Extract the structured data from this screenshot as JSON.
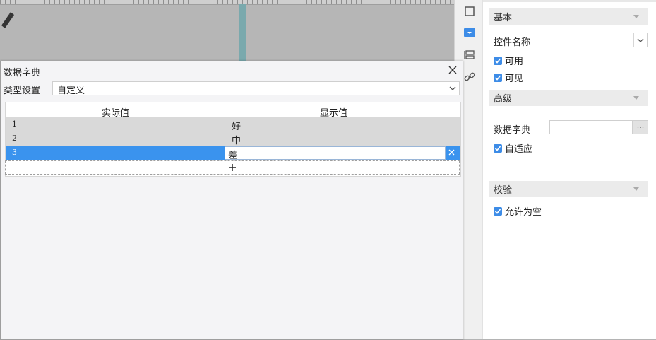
{
  "dialog": {
    "title": "数据字典",
    "type_label": "类型设置",
    "type_value": "自定义",
    "columns": [
      "实际值",
      "显示值"
    ],
    "rows": [
      {
        "actual": "1",
        "display": "好"
      },
      {
        "actual": "2",
        "display": "中"
      },
      {
        "actual": "3",
        "display": "差"
      }
    ]
  },
  "panel": {
    "basic_header": "基本",
    "control_name_label": "控件名称",
    "enabled_label": "可用",
    "visible_label": "可见",
    "advanced_header": "高级",
    "data_dict_label": "数据字典",
    "auto_fit_label": "自适应",
    "validation_header": "校验",
    "allow_empty_label": "允许为空",
    "ellipsis": "···"
  },
  "colors": {
    "selected_row": "#3a93ee",
    "checkbox": "#3d8ce7",
    "accent": "#3d8ce7"
  }
}
